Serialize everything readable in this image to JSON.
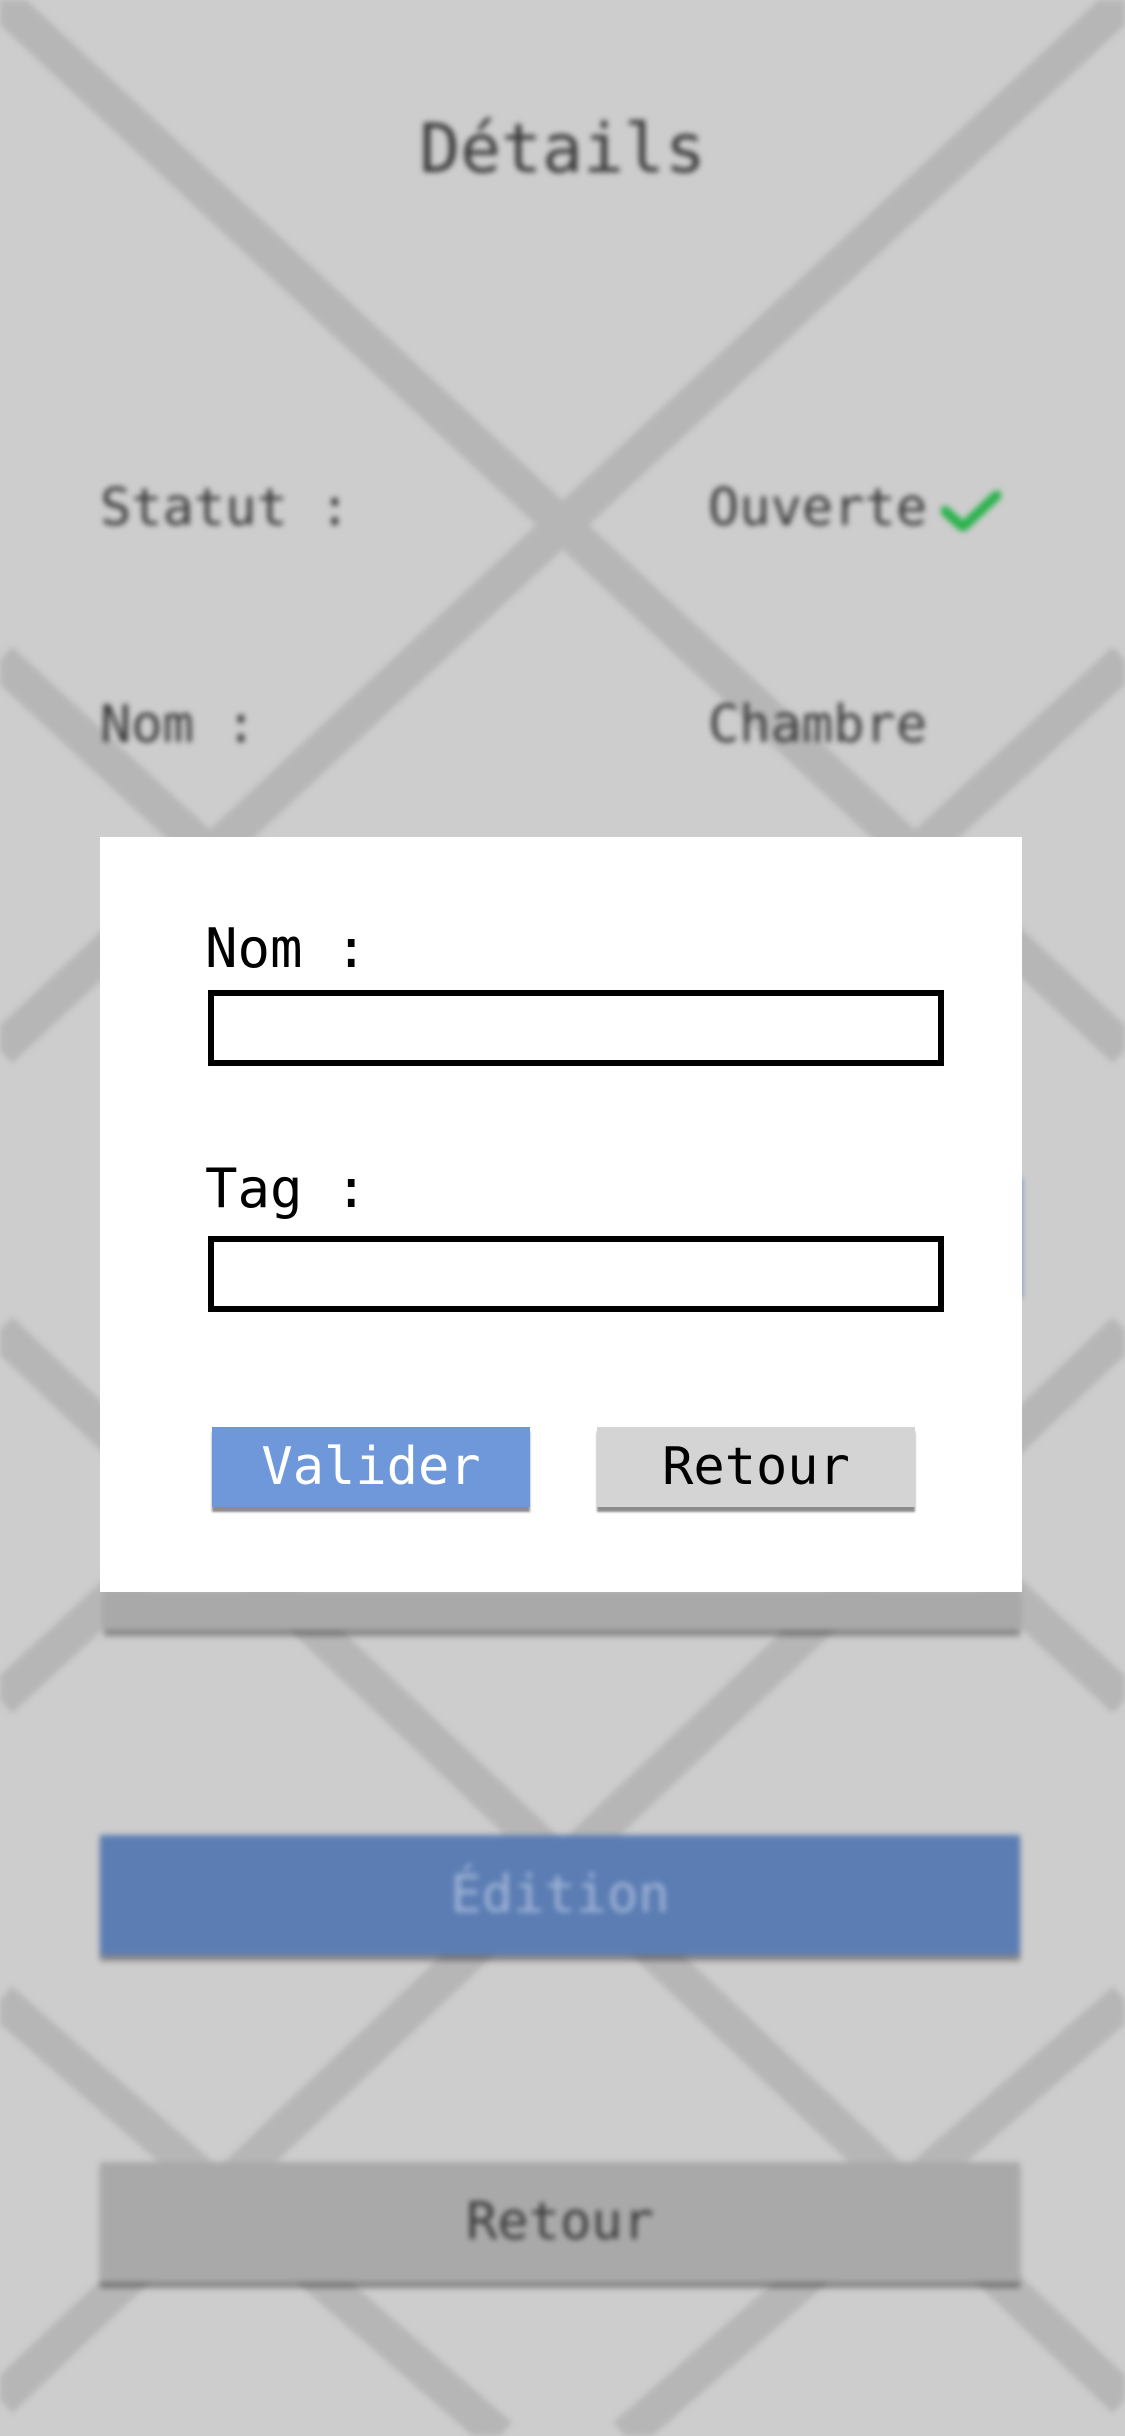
{
  "background": {
    "title": "Détails",
    "rows": [
      {
        "label": "Statut :",
        "value": "Ouverte"
      },
      {
        "label": "Nom :",
        "value": "Chambre"
      }
    ],
    "status_icon": "checkmark-icon",
    "edit_button": "Édition",
    "back_button": "Retour"
  },
  "modal": {
    "name_label": "Nom :",
    "name_value": "",
    "tag_label": "Tag :",
    "tag_value": "",
    "confirm_button": "Valider",
    "back_button": "Retour"
  },
  "colors": {
    "background": "#cdcdcd",
    "accent_blue": "#6f98da",
    "edit_blue": "#5b7db3",
    "check_green": "#2bb24c",
    "grey_button": "#a9a9a9"
  }
}
